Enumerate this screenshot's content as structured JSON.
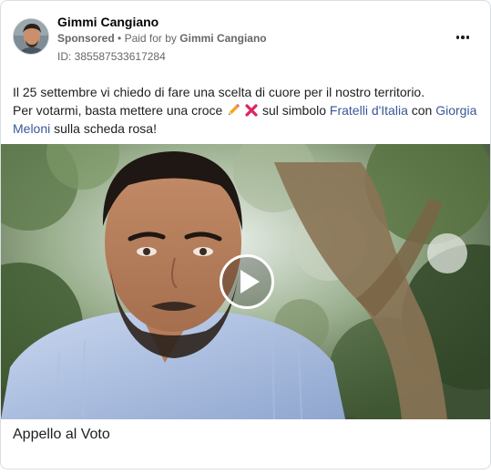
{
  "post": {
    "author": "Gimmi Cangiano",
    "sponsored_label": "Sponsored",
    "separator": "•",
    "paid_for_prefix": "Paid for by",
    "paid_for_name": "Gimmi Cangiano",
    "ad_id": "ID: 385587533617284",
    "more_icon": "more-options-icon"
  },
  "body": {
    "line1": "Il 25 settembre vi chiedo di fare una scelta di cuore per il nostro territorio.",
    "line2_start": "Per votarmi, basta mettere una croce",
    "emoji_pencil": "pencil-emoji",
    "emoji_cross": "cross-mark-emoji",
    "line2_mid": "sul simbolo",
    "party_link": "Fratelli d'Italia",
    "connector": "con",
    "leader_link": "Giorgia Meloni",
    "line_end": "sulla scheda rosa!"
  },
  "media": {
    "type": "video",
    "play_icon": "play-icon",
    "caption": "Appello al Voto"
  },
  "colors": {
    "link": "#385898",
    "secondary_text": "#65676b",
    "border": "#dadde1"
  }
}
